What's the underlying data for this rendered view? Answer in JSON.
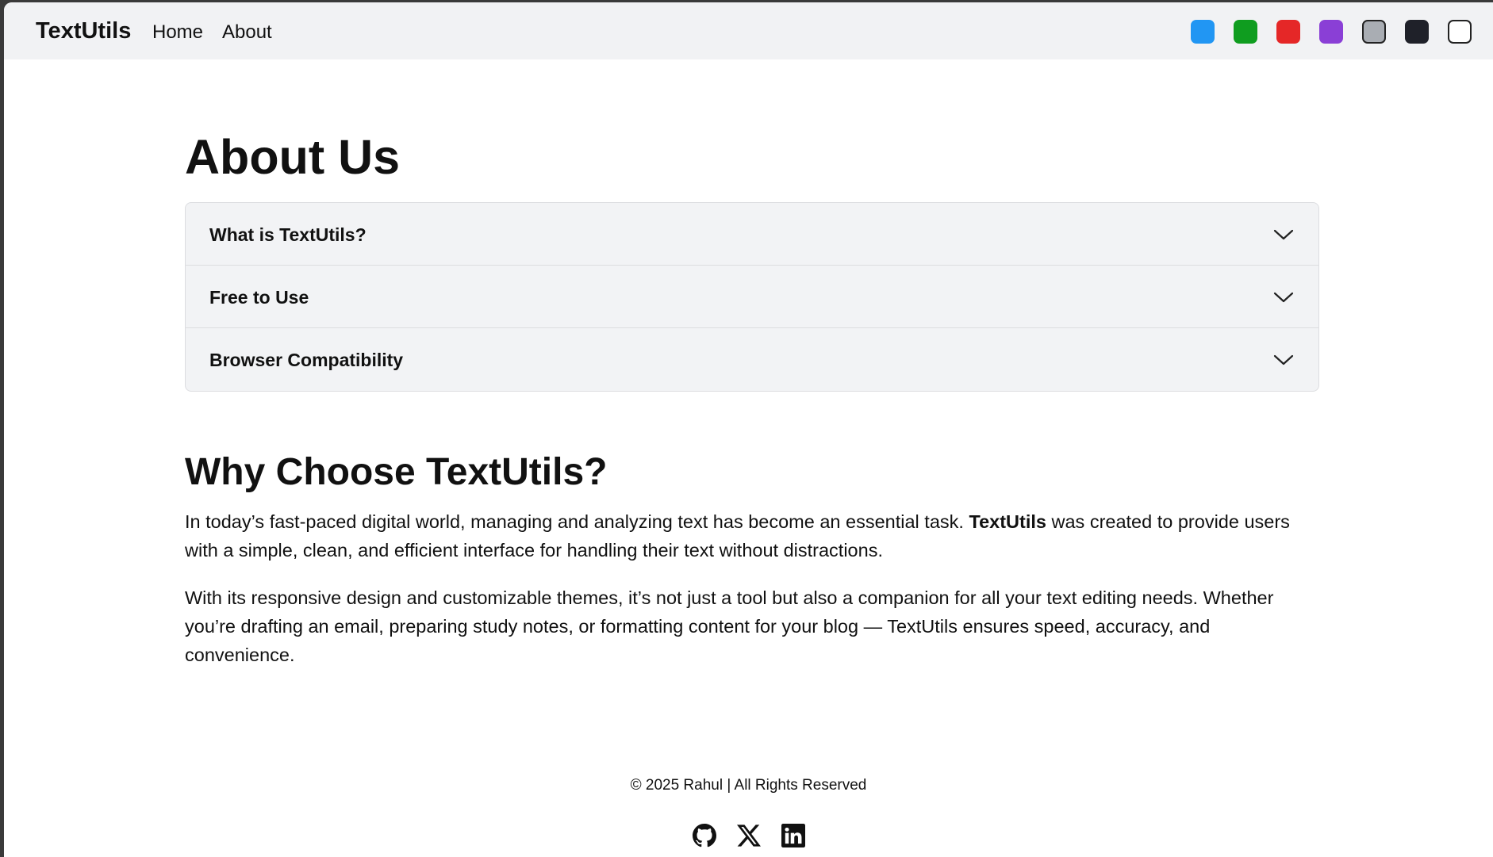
{
  "navbar": {
    "brand": "TextUtils",
    "links": [
      {
        "label": "Home"
      },
      {
        "label": "About"
      }
    ],
    "theme_swatches": [
      {
        "name": "blue",
        "color": "#2196f3"
      },
      {
        "name": "green",
        "color": "#0f9d1f"
      },
      {
        "name": "red",
        "color": "#e52727"
      },
      {
        "name": "purple",
        "color": "#8a3fd6"
      },
      {
        "name": "gray",
        "color": "#a9adb3"
      },
      {
        "name": "dark",
        "color": "#1f2129"
      },
      {
        "name": "light",
        "color": "#ffffff"
      }
    ]
  },
  "main": {
    "title": "About Us",
    "accordion": [
      {
        "label": "What is TextUtils?"
      },
      {
        "label": "Free to Use"
      },
      {
        "label": "Browser Compatibility"
      }
    ],
    "why_title": "Why Choose TextUtils?",
    "para1_before": "In today’s fast-paced digital world, managing and analyzing text has become an essential task. ",
    "para1_bold": "TextUtils",
    "para1_after": " was created to provide users with a simple, clean, and efficient interface for handling their text without distractions.",
    "para2": "With its responsive design and customizable themes, it’s not just a tool but also a companion for all your text editing needs. Whether you’re drafting an email, preparing study notes, or formatting content for your blog — TextUtils ensures speed, accuracy, and convenience."
  },
  "footer": {
    "copyright": "© 2025 Rahul | All Rights Reserved",
    "socials": [
      "github-icon",
      "x-icon",
      "linkedin-icon"
    ]
  }
}
